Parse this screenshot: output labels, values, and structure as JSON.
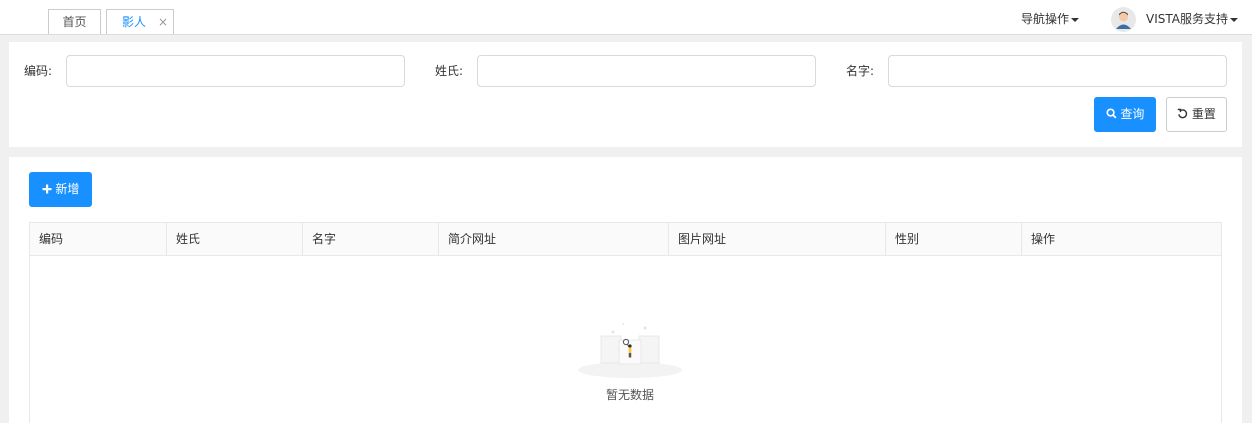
{
  "tabs": [
    {
      "label": "首页"
    },
    {
      "label": "影人",
      "close": "×"
    }
  ],
  "header": {
    "nav_label": "导航操作",
    "user_name": "VISTA服务支持"
  },
  "search": {
    "code_label": "编码:",
    "surname_label": "姓氏:",
    "name_label": "名字:",
    "code_value": "",
    "surname_value": "",
    "name_value": "",
    "query_label": "查询",
    "reset_label": "重置"
  },
  "toolbar": {
    "add_label": "新增"
  },
  "table": {
    "columns": [
      "编码",
      "姓氏",
      "名字",
      "简介网址",
      "图片网址",
      "性别",
      "操作"
    ],
    "rows": [],
    "empty_text": "暂无数据"
  },
  "colors": {
    "accent": "#1890ff"
  }
}
